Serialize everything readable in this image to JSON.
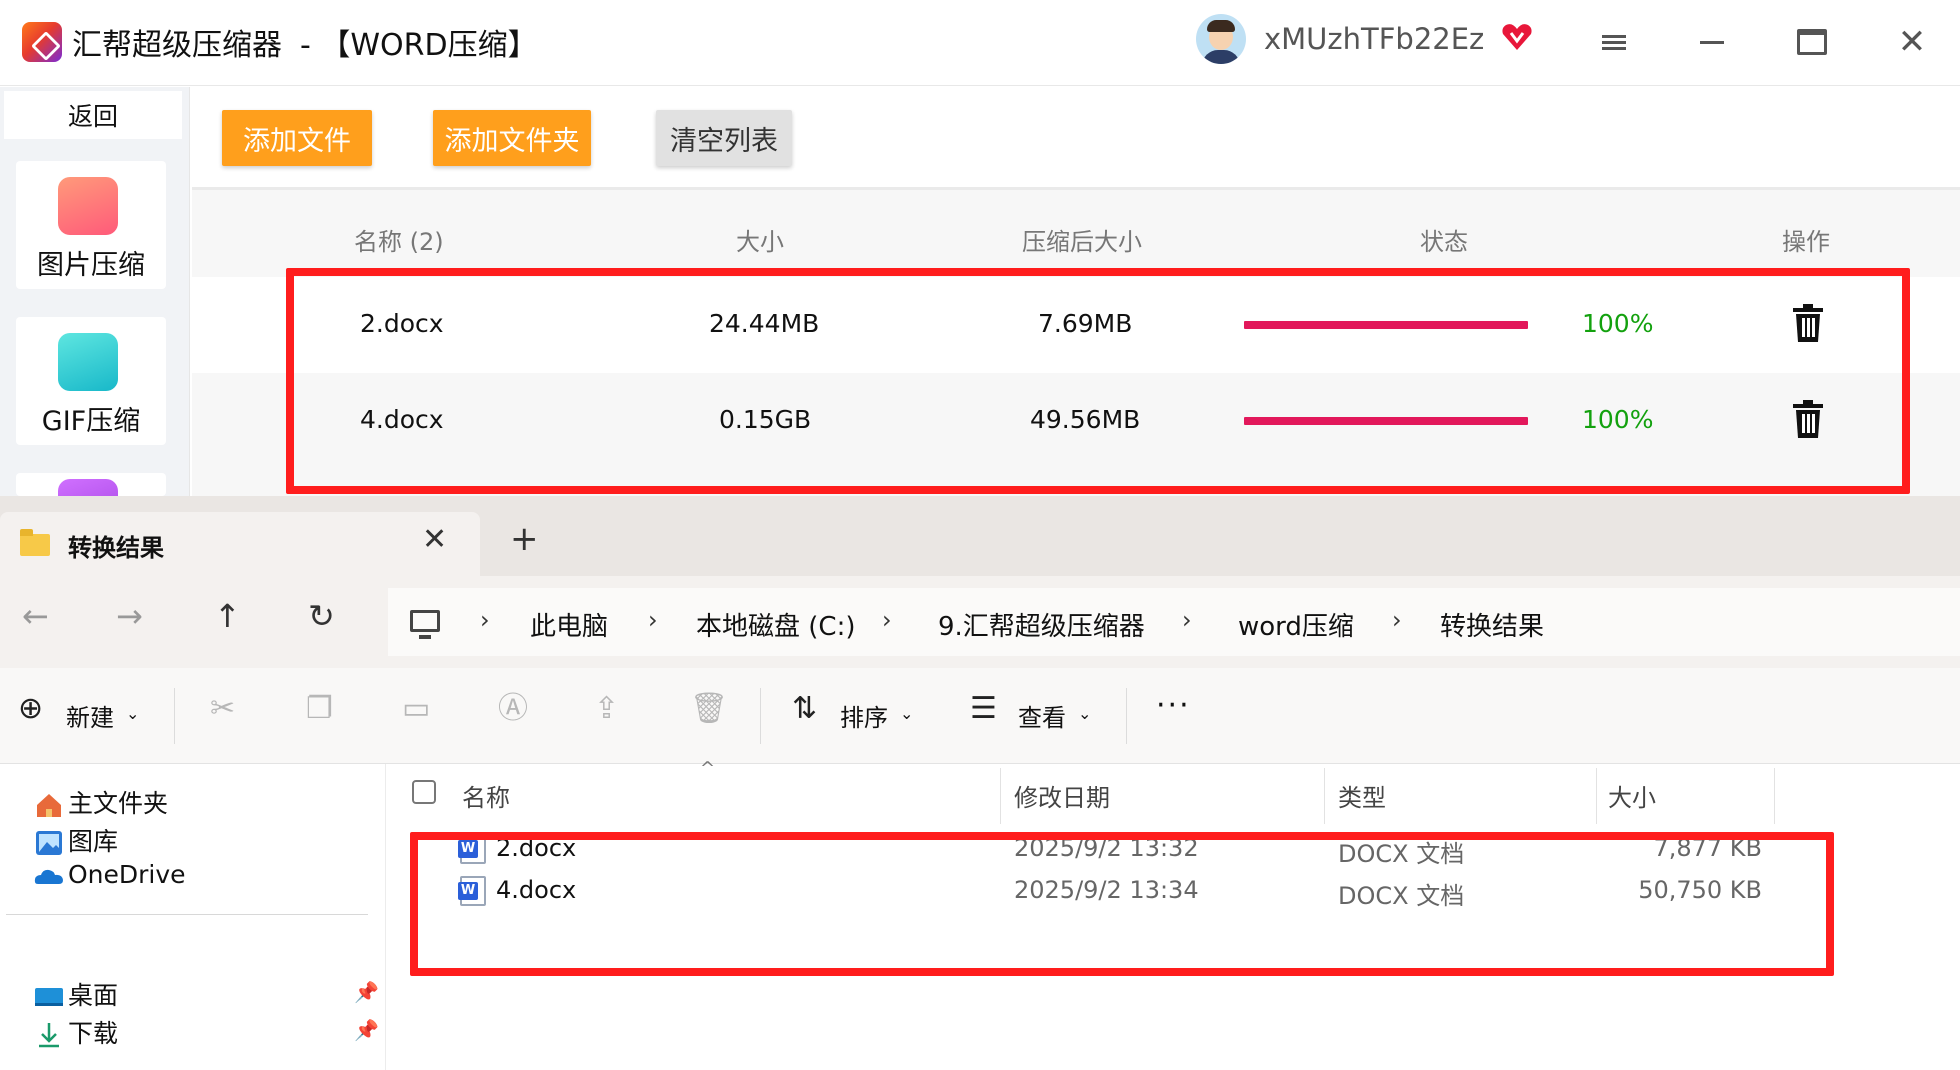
{
  "app": {
    "title": "汇帮超级压缩器",
    "mode": "-  【WORD压缩】",
    "username": "xMUzhTFb22Ez",
    "brand_color": "#ff9f1c",
    "icons": [
      "app-logo-icon",
      "avatar",
      "vip-heart-icon",
      "menu-icon",
      "minimize-icon",
      "maximize-icon",
      "close-icon"
    ]
  },
  "sidebar": {
    "back_label": "返回",
    "items": [
      {
        "label": "图片压缩",
        "icon": "image-compress-icon"
      },
      {
        "label": "GIF压缩",
        "icon": "gif-compress-icon"
      }
    ]
  },
  "toolbar": {
    "add_file": "添加文件",
    "add_folder": "添加文件夹",
    "clear_list": "清空列表"
  },
  "table": {
    "headers": [
      "名称 (2)",
      "大小",
      "压缩后大小",
      "状态",
      "操作"
    ],
    "rows": [
      {
        "name": "2.docx",
        "size": "24.44MB",
        "compressed": "7.69MB",
        "progress": 1.0,
        "status": "100%"
      },
      {
        "name": "4.docx",
        "size": "0.15GB",
        "compressed": "49.56MB",
        "progress": 1.0,
        "status": "100%"
      }
    ],
    "progress_color": "#e2185b",
    "status_color": "#13a10e"
  },
  "explorer": {
    "tab_title": "转换结果",
    "breadcrumb": [
      "此电脑",
      "本地磁盘 (C:)",
      "9.汇帮超级压缩器",
      "word压缩",
      "转换结果"
    ],
    "commands": {
      "new": "新建",
      "sort": "排序",
      "view": "查看"
    },
    "nav": {
      "quick": [
        {
          "label": "主文件夹",
          "icon": "home-icon"
        },
        {
          "label": "图库",
          "icon": "gallery-icon"
        },
        {
          "label": "OneDrive",
          "icon": "onedrive-icon"
        }
      ],
      "pinned": [
        {
          "label": "桌面",
          "icon": "desktop-icon"
        },
        {
          "label": "下载",
          "icon": "download-icon"
        }
      ]
    },
    "columns": [
      "名称",
      "修改日期",
      "类型",
      "大小"
    ],
    "files": [
      {
        "name": "2.docx",
        "modified": "2025/9/2 13:32",
        "type": "DOCX 文档",
        "size": "7,877 KB"
      },
      {
        "name": "4.docx",
        "modified": "2025/9/2 13:34",
        "type": "DOCX 文档",
        "size": "50,750 KB"
      }
    ]
  },
  "highlight_color": "#ff1d1d"
}
